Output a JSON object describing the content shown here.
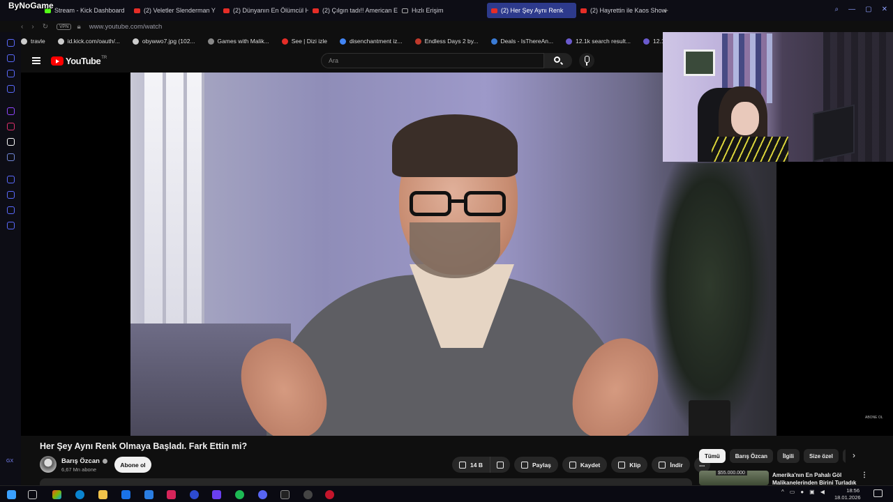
{
  "overlay_logo": "ByNoGame",
  "browser": {
    "tabs": [
      {
        "label": "Stream - Kick Dashboard",
        "fav": "kick"
      },
      {
        "label": "(2) Veletler Slenderman Y",
        "fav": "yt"
      },
      {
        "label": "(2) Dünyanın En Ölümcül H",
        "fav": "yt"
      },
      {
        "label": "(2) Çılgın tadı!! American E",
        "fav": "yt"
      },
      {
        "label": "Hızlı Erişim",
        "fav": "grid"
      },
      {
        "label": "(2) Her Şey Aynı Renk",
        "fav": "yt",
        "active": true
      },
      {
        "label": "(2) Hayrettin ile Kaos Show",
        "fav": "yt"
      }
    ],
    "new_tab": "+",
    "vpn": "VPN",
    "url": "www.youtube.com/watch",
    "bookmarks": [
      "travle",
      "id.kick.com/oauth/...",
      "obywwo7.jpg (102...",
      "Games with Malik...",
      "See | Dizi izle",
      "disenchantment iz...",
      "Endless Days 2 by...",
      "Deals - IsThereAn...",
      "12.1k search result...",
      "12.1k search res"
    ],
    "sidebar_label": "GX",
    "toolbar_ai": "AI"
  },
  "youtube": {
    "logo_text": "YouTube",
    "logo_region": "TR",
    "search_placeholder": "Ara",
    "video_overlay": "ABONE OL",
    "video_title": "Her Şey Aynı Renk Olmaya Başladı. Fark Ettin mi?",
    "channel_name": "Barış Özcan",
    "subscribers": "6,67 Mn abone",
    "subscribe_label": "Abone ol",
    "actions": {
      "like_count": "14 B",
      "share": "Paylaş",
      "save": "Kaydet",
      "clip": "Klip",
      "download": "İndir",
      "more": "..."
    },
    "chips": [
      "Tümü",
      "Barış Özcan",
      "İlgili",
      "Size özel",
      "Sc"
    ],
    "recommendation": {
      "thumb_text": "$55.000.000",
      "title": "Amerika'nın En Pahalı Göl Malikanelerinden Birini Turladık"
    }
  },
  "taskbar": {
    "time": "18:56",
    "date": "18.01.2026",
    "notif_count": "5"
  },
  "colors": {
    "accent": "#2d3a8c",
    "youtube_red": "#ff0000",
    "opera_blue": "#5b6bff"
  }
}
